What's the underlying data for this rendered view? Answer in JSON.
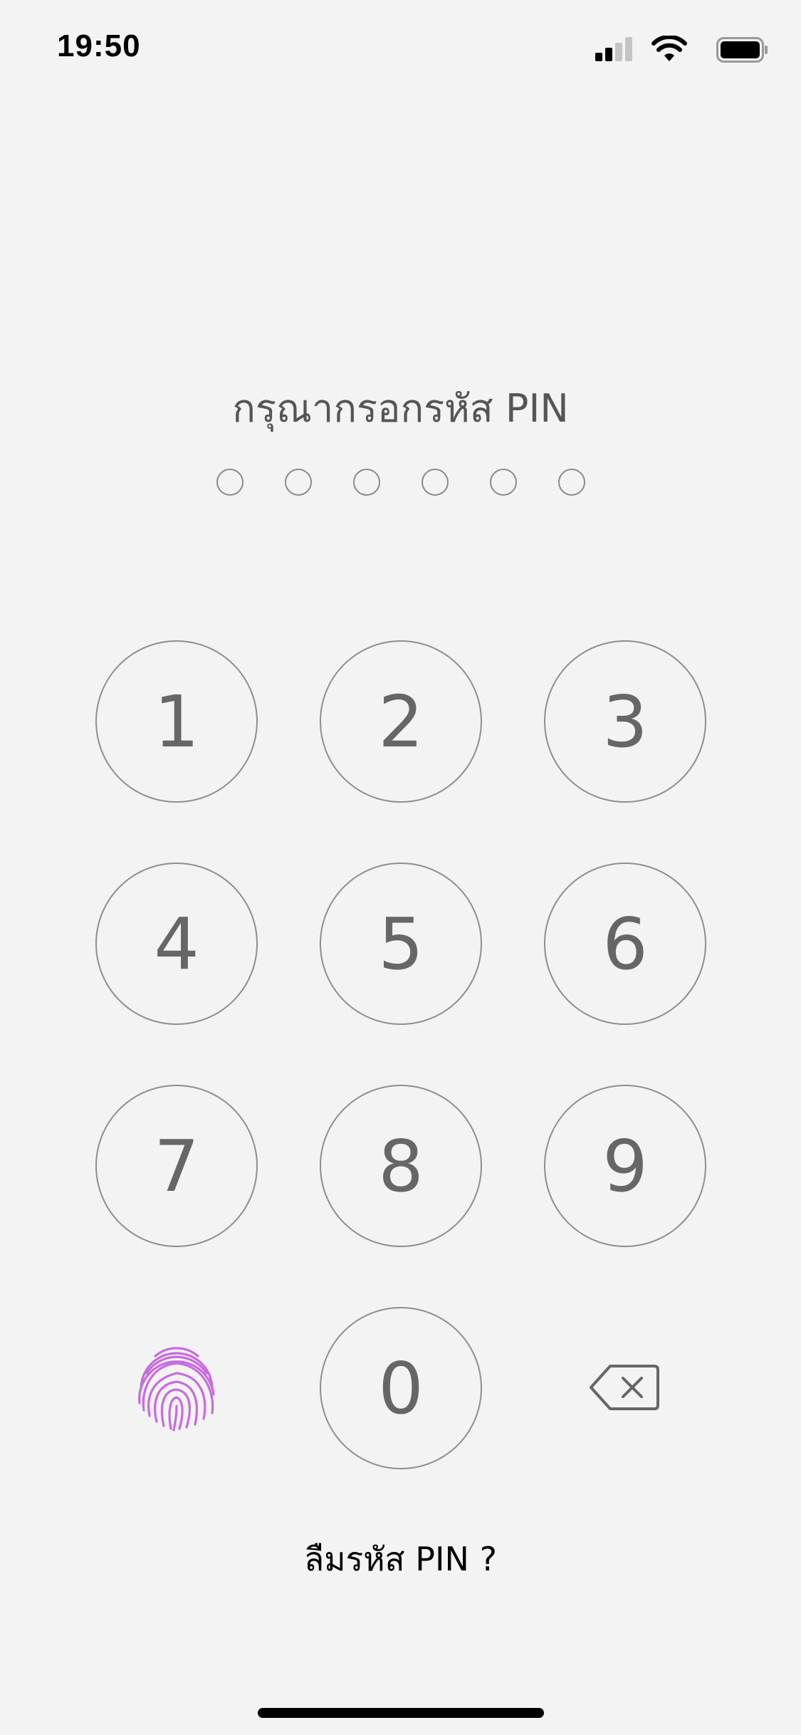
{
  "status_bar": {
    "time": "19:50",
    "icons": [
      "signal-icon",
      "wifi-icon",
      "battery-icon"
    ]
  },
  "pin_screen": {
    "title": "กรุณากรอกรหัส PIN",
    "pin_length": 6,
    "entered_digits": 0,
    "keys": [
      "1",
      "2",
      "3",
      "4",
      "5",
      "6",
      "7",
      "8",
      "9",
      "0"
    ],
    "forgot_label": "ลืมรหัส PIN ?",
    "fingerprint_icon": "fingerprint-icon",
    "backspace_icon": "backspace-icon"
  },
  "colors": {
    "background": "#f3f3f3",
    "key_border": "#8e8e8e",
    "key_text": "#666666",
    "fingerprint": "#c76be0"
  }
}
